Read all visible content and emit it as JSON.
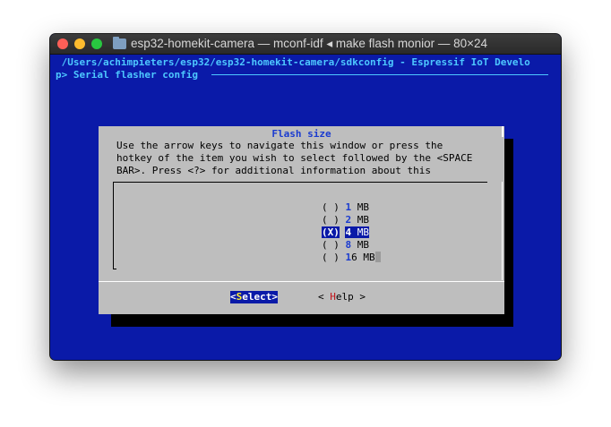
{
  "window": {
    "title": "esp32-homekit-camera — mconf-idf ◂ make flash monior — 80×24"
  },
  "terminal": {
    "header_line": " /Users/achimpieters/esp32/esp32-homekit-camera/sdkconfig - Espressif IoT Develo",
    "breadcrumb": "p> Serial flasher config"
  },
  "dialog": {
    "title": "Flash size",
    "help_lines": [
      "Use the arrow keys to navigate this window or press the",
      "hotkey of the item you wish to select followed by the <SPACE",
      "BAR>. Press <?> for additional information about this"
    ],
    "options": [
      {
        "mark": "( )",
        "hotkey": "1",
        "rest": " MB",
        "selected": false
      },
      {
        "mark": "( )",
        "hotkey": "2",
        "rest": " MB",
        "selected": false
      },
      {
        "mark": "(X)",
        "hotkey": "4",
        "rest": " MB",
        "selected": true
      },
      {
        "mark": "( )",
        "hotkey": "8",
        "rest": " MB",
        "selected": false
      },
      {
        "mark": "( )",
        "hotkey": "1",
        "rest": "6 MB",
        "selected": false
      }
    ],
    "buttons": {
      "select": {
        "open": "<",
        "hot": "S",
        "rest": "elect>"
      },
      "help": {
        "open": "< ",
        "hot": "H",
        "rest": "elp >"
      }
    }
  }
}
